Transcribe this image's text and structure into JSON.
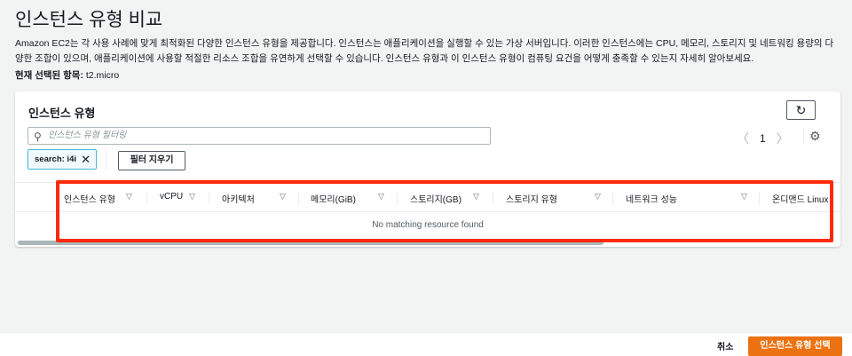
{
  "page": {
    "title": "인스턴스 유형 비교",
    "description": "Amazon EC2는 각 사용 사례에 맞게 최적화된 다양한 인스턴스 유형을 제공합니다. 인스턴스는 애플리케이션을 실행할 수 있는 가상 서버입니다. 이러한 인스턴스에는 CPU, 메모리, 스토리지 및 네트워킹 용량의 다양한 조합이 있으며, 애플리케이션에 사용할 적절한 리소스 조합을 유연하게 선택할 수 있습니다. 인스턴스 유형과 이 인스턴스 유형이 컴퓨팅 요건을 어떻게 충족할 수 있는지 자세히 알아보세요.",
    "current_label": "현재 선택된 항목:",
    "current_value": "t2.micro"
  },
  "panel": {
    "title": "인스턴스 유형",
    "search_placeholder": "인스턴스 유형 필터링",
    "page_number": "1",
    "filter_token": "search: i4i",
    "clear_filters": "필터 지우기",
    "columns": [
      "인스턴스 유형",
      "vCPU",
      "아키텍처",
      "메모리(GiB)",
      "스토리지(GB)",
      "스토리지 유형",
      "네트워크 성능",
      "온디맨드 Linux"
    ],
    "empty_message": "No matching resource found"
  },
  "footer": {
    "cancel": "취소",
    "select": "인스턴스 유형 선택"
  },
  "colors": {
    "accent": "#ec7211",
    "highlight": "#ff2a0a",
    "token_border": "#44b9d6"
  }
}
